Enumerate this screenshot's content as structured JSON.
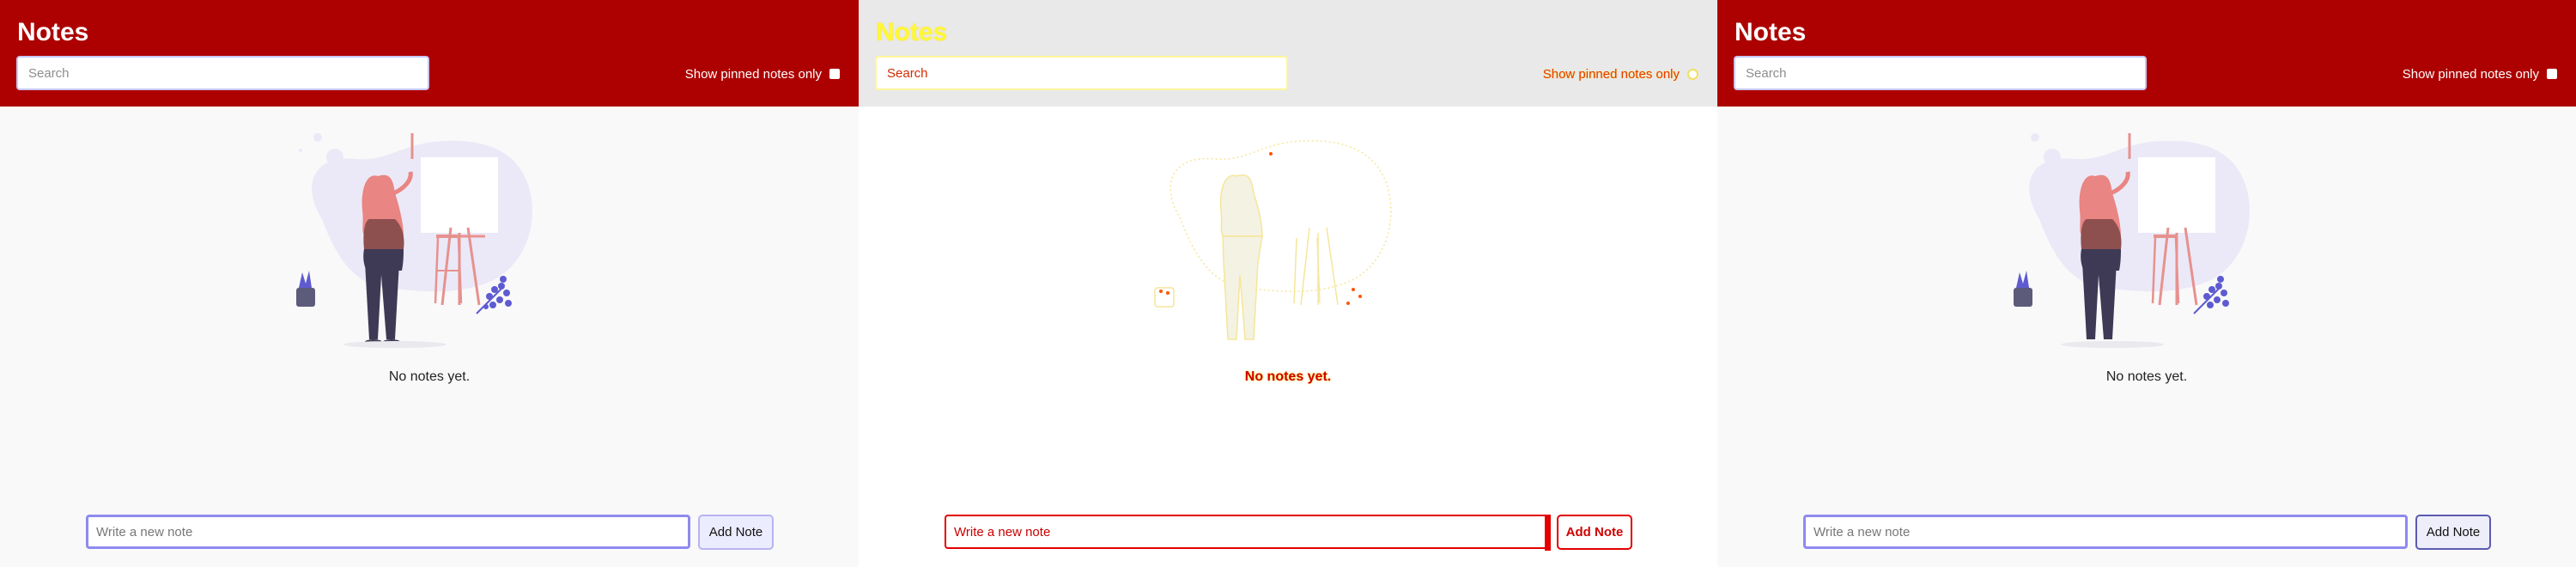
{
  "app": {
    "title": "Notes",
    "search_placeholder": "Search",
    "pinned_filter_label": "Show pinned notes only",
    "empty_state_text": "No notes yet.",
    "new_note_placeholder": "Write a new note",
    "add_button_label": "Add Note"
  },
  "colors": {
    "header": "#ad0000",
    "accent": "#8f8aef",
    "page_background": "#f9f9f9",
    "overlay_text": "#d00000",
    "overlay_highlight": "#fff73a"
  },
  "icons": {
    "illustration": "woman-painting-at-easel-illustration"
  }
}
